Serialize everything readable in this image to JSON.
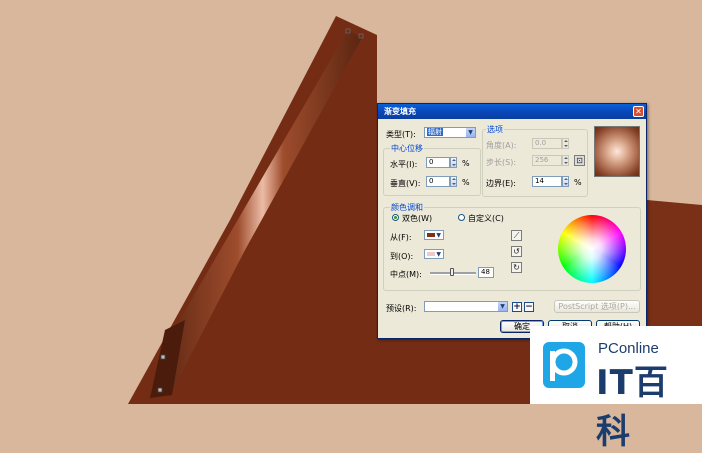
{
  "dialog": {
    "title": "渐变填充",
    "close_glyph": "✕",
    "type_label": "类型(T):",
    "type_value": "辐射",
    "options_group": "选项",
    "angle_label": "角度(A):",
    "angle_value": "0.0",
    "steps_label": "步长(S):",
    "steps_value": "256",
    "edge_label": "边界(E):",
    "edge_value": "14",
    "center_group": "中心位移",
    "horizontal_label": "水平(I):",
    "horizontal_value": "0",
    "vertical_label": "垂直(V):",
    "vertical_value": "0",
    "percent": "%",
    "color_group": "颜色调和",
    "two_color_label": "双色(W)",
    "custom_label": "自定义(C)",
    "from_label": "从(F):",
    "to_label": "到(O):",
    "midpoint_label": "中点(M):",
    "midpoint_value": "48",
    "midpoint_fraction": 0.48,
    "preset_label": "预设(R):",
    "postscript_label": "PostScript 选项(P)...",
    "ok_label": "确定",
    "cancel_label": "取消",
    "help_label": "帮助(H)",
    "from_color": "#7a3318",
    "to_color": "#f0c8c8"
  },
  "watermark": {
    "brand_small": "PConline",
    "brand_big": "IT百科"
  }
}
